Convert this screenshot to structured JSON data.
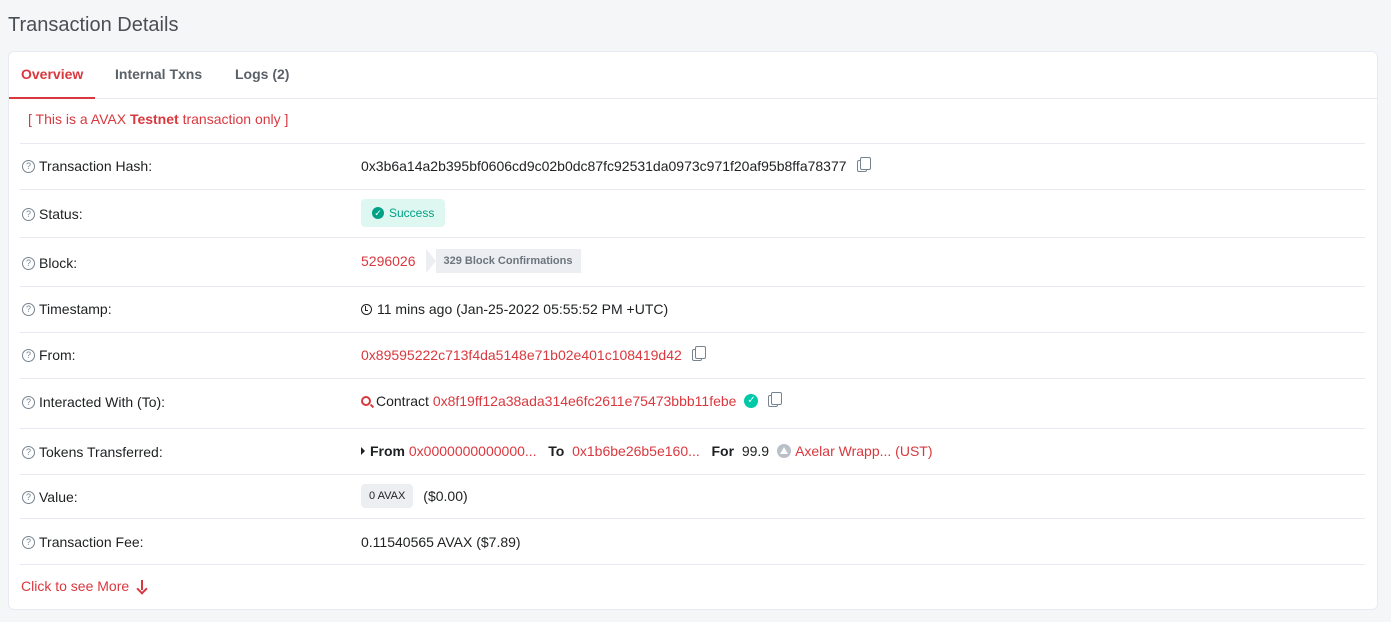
{
  "page": {
    "title": "Transaction Details"
  },
  "tabs": [
    {
      "label": "Overview"
    },
    {
      "label": "Internal Txns"
    },
    {
      "label": "Logs (2)"
    }
  ],
  "notice": {
    "prefix": "[ This is a AVAX ",
    "bold": "Testnet",
    "suffix": " transaction only ]"
  },
  "rows": {
    "hash": {
      "label": "Transaction Hash:",
      "value": "0x3b6a14a2b395bf0606cd9c02b0dc87fc92531da0973c971f20af95b8ffa78377"
    },
    "status": {
      "label": "Status:",
      "value": "Success"
    },
    "block": {
      "label": "Block:",
      "value": "5296026",
      "confirmations": "329 Block Confirmations"
    },
    "timestamp": {
      "label": "Timestamp:",
      "value": "11 mins ago (Jan-25-2022 05:55:52 PM +UTC)"
    },
    "from": {
      "label": "From:",
      "value": "0x89595222c713f4da5148e71b02e401c108419d42"
    },
    "to": {
      "label": "Interacted With (To):",
      "prefix": "Contract",
      "value": "0x8f19ff12a38ada314e6fc2611e75473bbb11febe"
    },
    "tokens": {
      "label": "Tokens Transferred:",
      "from_label": "From",
      "from_value": "0x0000000000000...",
      "to_label": "To",
      "to_value": "0x1b6be26b5e160...",
      "for_label": "For",
      "amount": "99.9",
      "token_name": "Axelar Wrapp... (UST)"
    },
    "value": {
      "label": "Value:",
      "badge": "0 AVAX",
      "usd": "($0.00)"
    },
    "fee": {
      "label": "Transaction Fee:",
      "value": "0.11540565 AVAX ($7.89)"
    }
  },
  "more": {
    "label": "Click to see More"
  },
  "colors": {
    "accent": "#d9383e",
    "success": "#00a186"
  }
}
